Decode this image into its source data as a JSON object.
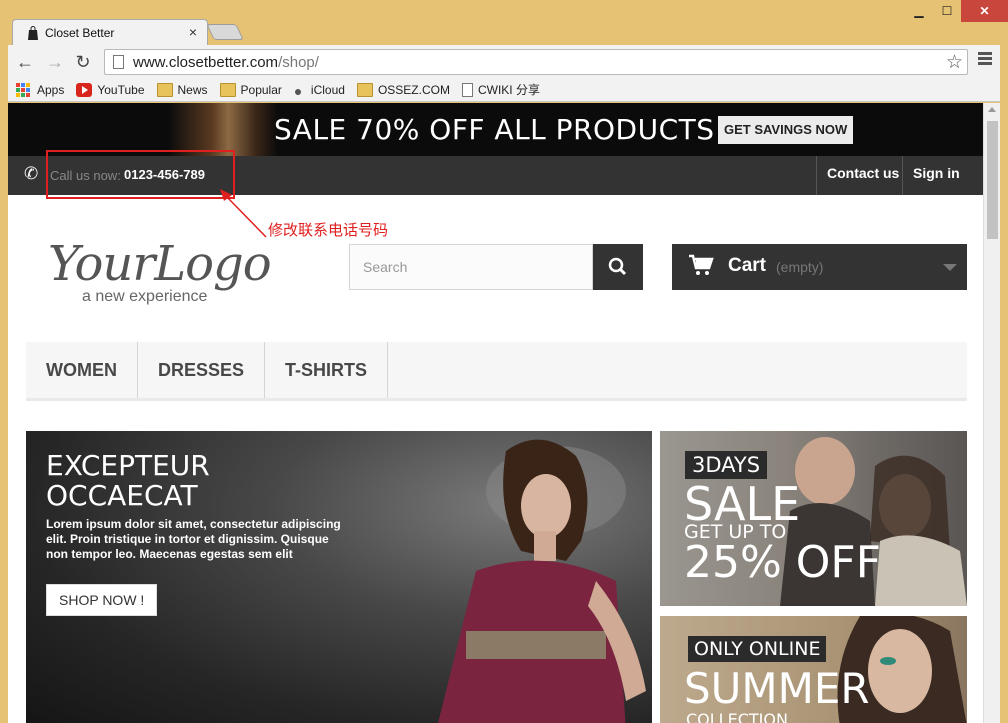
{
  "browser": {
    "tab_title": "Closet Better",
    "tab_close": "×",
    "url_host": "www.closetbetter.com",
    "url_path": "/shop/",
    "bookmarks": [
      "Apps",
      "YouTube",
      "News",
      "Popular",
      "iCloud",
      "OSSEZ.COM",
      "CWIKI 分享"
    ]
  },
  "promo": {
    "headline": "SALE 70% OFF ALL PRODUCTS",
    "button": "GET SAVINGS NOW"
  },
  "infobar": {
    "call_label": "Call us now:",
    "phone": "0123-456-789",
    "contact": "Contact us",
    "signin": "Sign in"
  },
  "annotation": {
    "text": "修改联系电话号码",
    "color": "#e0201f"
  },
  "logo": {
    "name": "YourLogo",
    "tagline": "a new experience"
  },
  "search": {
    "placeholder": "Search"
  },
  "cart": {
    "label": "Cart",
    "status": "(empty)"
  },
  "menu": [
    "WOMEN",
    "DRESSES",
    "T-SHIRTS"
  ],
  "hero": {
    "title_line1": "EXCEPTEUR",
    "title_line2": "OCCAECAT",
    "body": "Lorem ipsum dolor sit amet, consectetur adipiscing elit. Proin tristique in tortor et dignissim. Quisque non tempor leo. Maecenas egestas sem elit",
    "button": "SHOP NOW !"
  },
  "side_banner_1": {
    "tag": "3DAYS",
    "sale": "SALE",
    "get": "GET UP TO",
    "pct": "25% OFF"
  },
  "side_banner_2": {
    "tag": "ONLY ONLINE",
    "big": "SUMMER",
    "sub": "COLLECTION"
  },
  "colors": {
    "frame": "#e6c275",
    "dark_bar": "#333333",
    "annotation": "#e0201f"
  }
}
